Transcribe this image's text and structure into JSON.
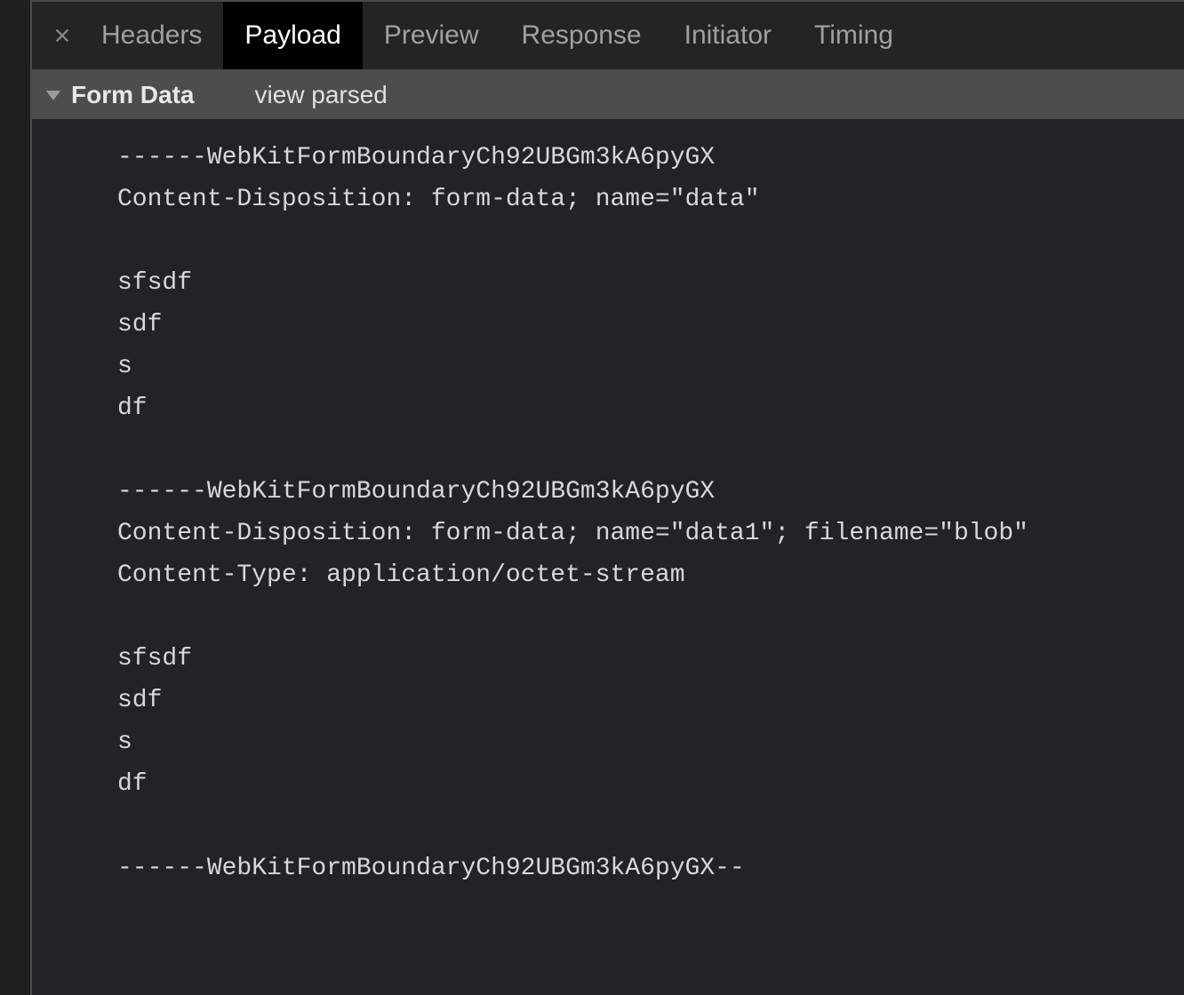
{
  "tabs": {
    "headers": "Headers",
    "payload": "Payload",
    "preview": "Preview",
    "response": "Response",
    "initiator": "Initiator",
    "timing": "Timing"
  },
  "section": {
    "title": "Form Data",
    "view_parsed": "view parsed"
  },
  "payload": "------WebKitFormBoundaryCh92UBGm3kA6pyGX\nContent-Disposition: form-data; name=\"data\"\n\nsfsdf\nsdf\ns\ndf\n\n------WebKitFormBoundaryCh92UBGm3kA6pyGX\nContent-Disposition: form-data; name=\"data1\"; filename=\"blob\"\nContent-Type: application/octet-stream\n\nsfsdf\nsdf\ns\ndf\n\n------WebKitFormBoundaryCh92UBGm3kA6pyGX--"
}
